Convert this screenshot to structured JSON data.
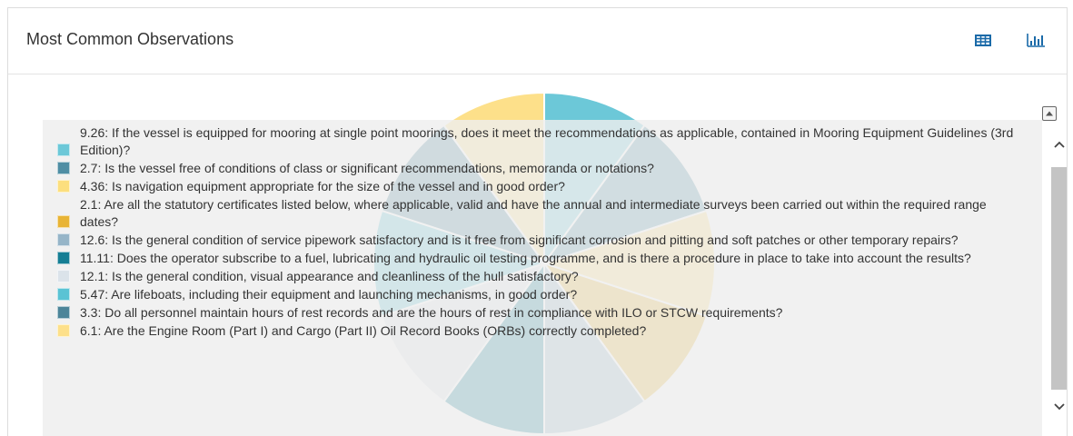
{
  "panel": {
    "title": "Most Common Observations",
    "buttons": [
      {
        "name": "table-view-button",
        "icon": "table-icon",
        "color": "#1a6aa8"
      },
      {
        "name": "chart-view-button",
        "icon": "bar-chart-icon",
        "color": "#1a6aa8"
      }
    ]
  },
  "legend": {
    "collapse_icon": "collapse-up-icon",
    "items": [
      {
        "label": "9.26: If the vessel is equipped for mooring at single point moorings, does it meet the recommendations as applicable, contained in Mooring Equipment Guidelines (3rd Edition)?",
        "color": "#6cc8d8"
      },
      {
        "label": "2.7: Is the vessel free of conditions of class or significant recommendations, memoranda or notations?",
        "color": "#4f8ea4"
      },
      {
        "label": "4.36: Is navigation equipment appropriate for the size of the vessel and in good order?",
        "color": "#fcdf7e"
      },
      {
        "label": "2.1: Are all the statutory certificates listed below, where applicable, valid and have the annual and intermediate surveys been carried out within the required range dates?",
        "color": "#e8b435"
      },
      {
        "label": "12.6: Is the general condition of service pipework satisfactory and is it free from significant corrosion and pitting and soft patches or other temporary repairs?",
        "color": "#96b5c8"
      },
      {
        "label": "11.11: Does the operator subscribe to a fuel, lubricating and hydraulic oil testing programme, and is there a procedure in place to take into account the results?",
        "color": "#157e94"
      },
      {
        "label": "12.1: Is the general condition, visual appearance and cleanliness of the hull satisfactory?",
        "color": "#dbe3ea"
      },
      {
        "label": "5.47: Are lifeboats, including their equipment and launching mechanisms, in good order?",
        "color": "#5ac3d4"
      },
      {
        "label": "3.3: Do all personnel maintain hours of rest records and are the hours of rest in compliance with ILO or STCW requirements?",
        "color": "#4c8599"
      },
      {
        "label": "6.1: Are the Engine Room (Part I) and Cargo (Part II) Oil Record Books (ORBs) correctly completed?",
        "color": "#fde08a"
      }
    ]
  },
  "scrollbar": {
    "up_icon": "chevron-up-icon",
    "down_icon": "chevron-down-icon"
  },
  "chart_data": {
    "type": "pie",
    "categories": [
      "9.26",
      "2.7",
      "4.36",
      "2.1",
      "12.6",
      "11.11",
      "12.1",
      "5.47",
      "3.3",
      "6.1"
    ],
    "values": [
      1,
      1,
      1,
      1,
      1,
      1,
      1,
      1,
      1,
      1
    ],
    "colors": [
      "#6cc8d8",
      "#4f8ea4",
      "#fcdf7e",
      "#e8b435",
      "#96b5c8",
      "#157e94",
      "#dbe3ea",
      "#5ac3d4",
      "#4c8599",
      "#fde08a"
    ]
  }
}
